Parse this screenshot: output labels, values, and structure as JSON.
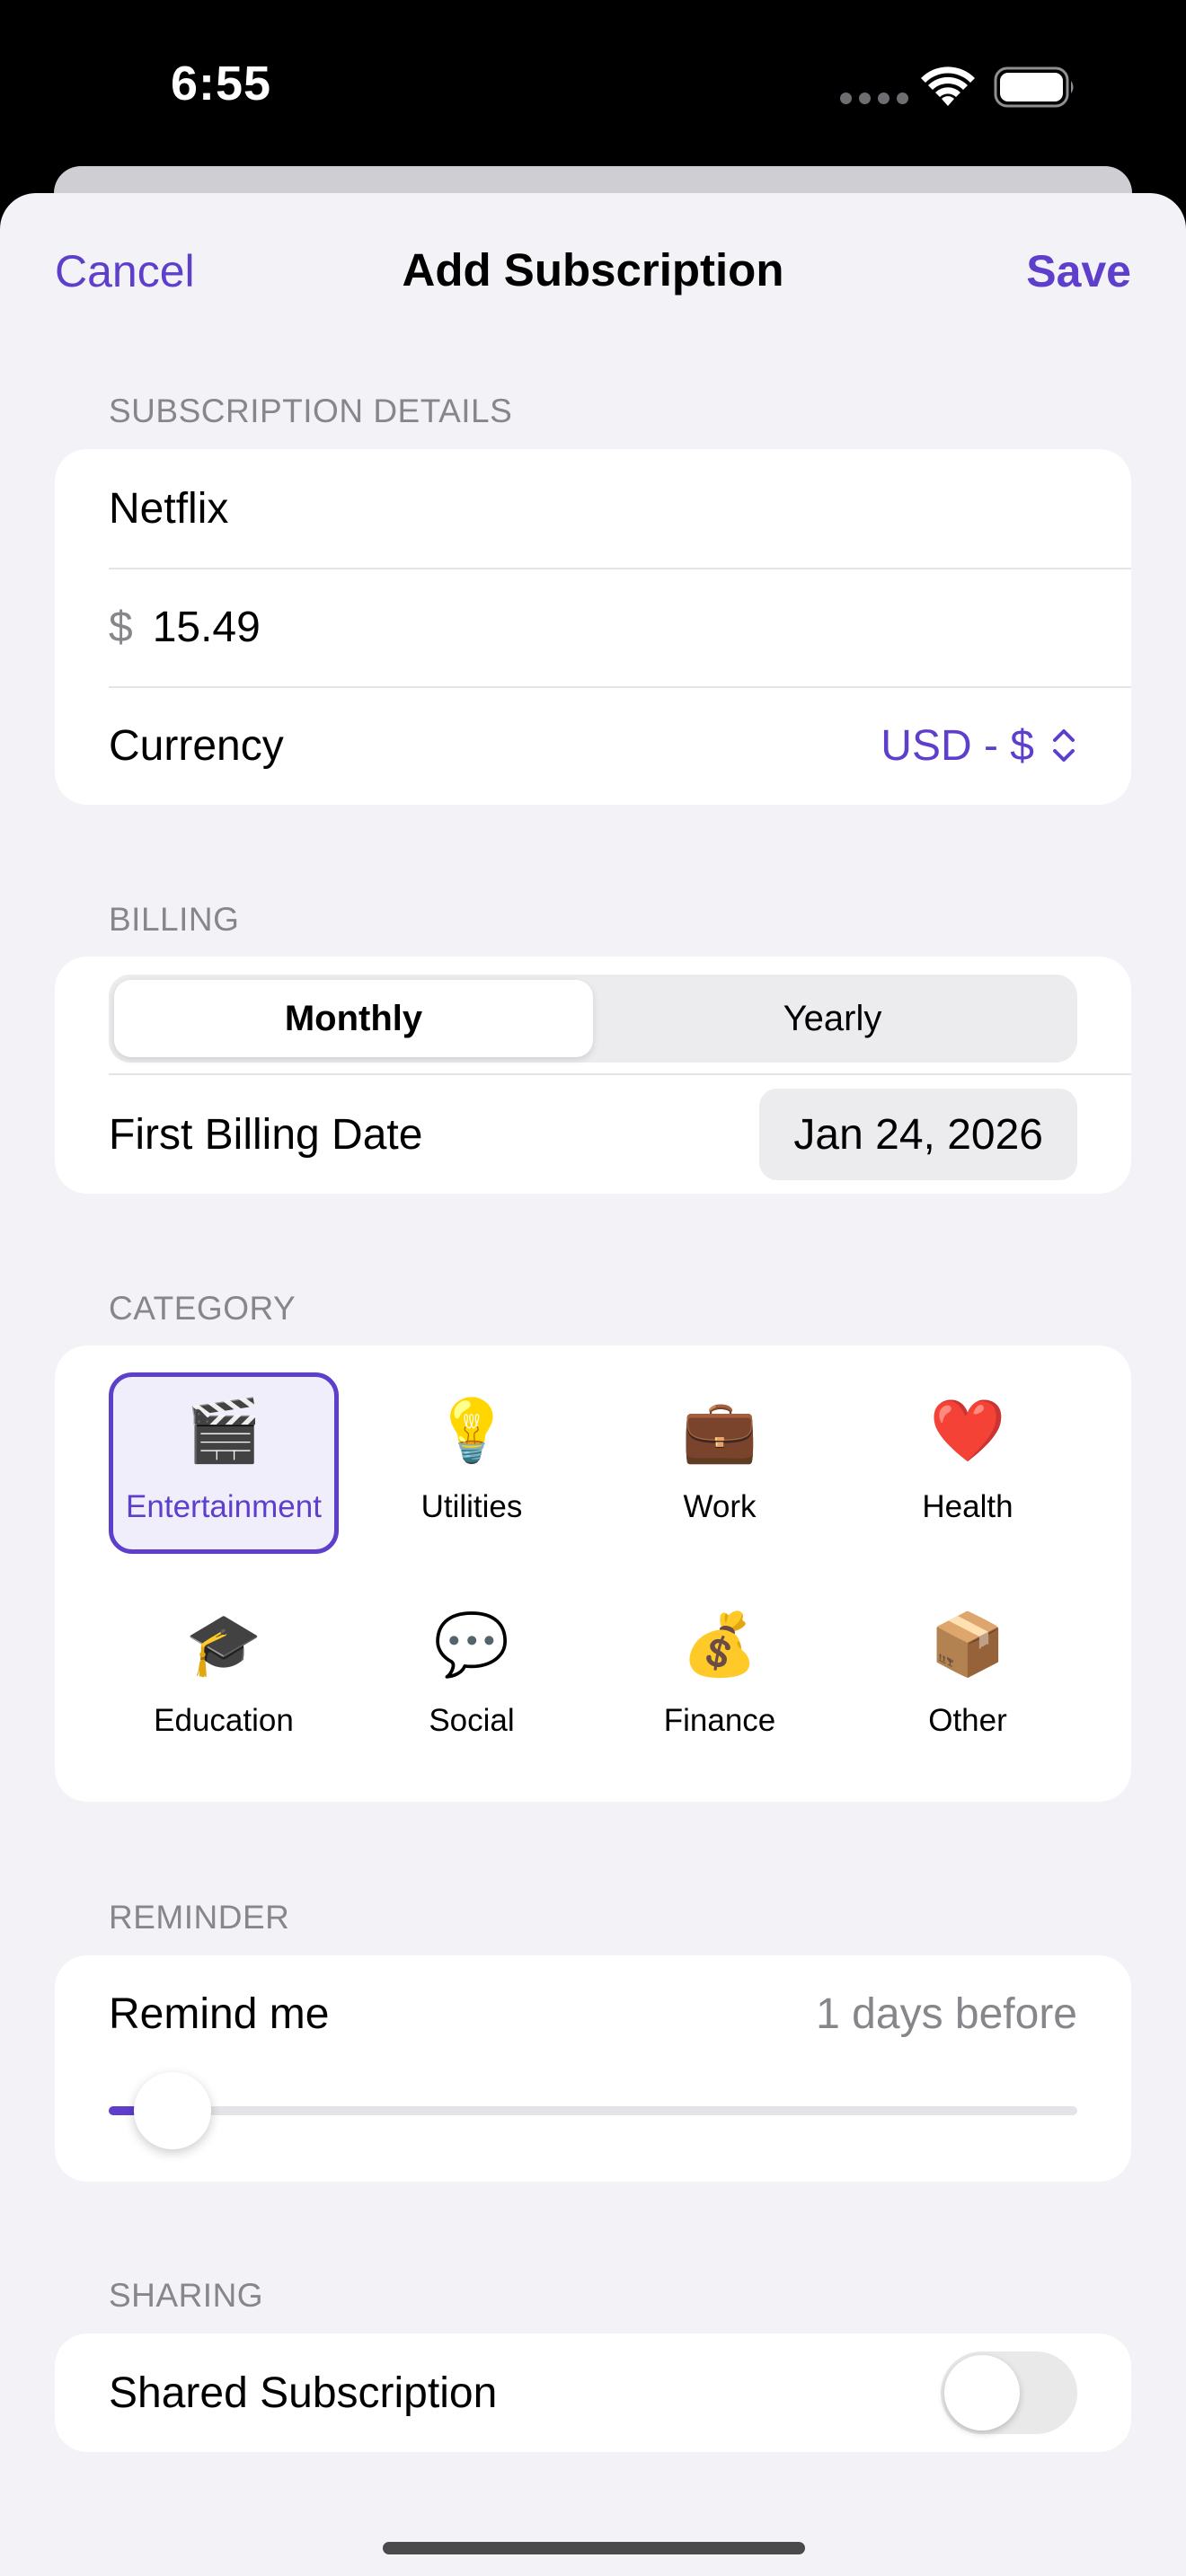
{
  "status_bar": {
    "time": "6:55"
  },
  "nav": {
    "cancel_label": "Cancel",
    "title": "Add Subscription",
    "save_label": "Save"
  },
  "details": {
    "header": "SUBSCRIPTION DETAILS",
    "name_value": "Netflix",
    "price_symbol": "$",
    "price_value": "15.49",
    "currency_label": "Currency",
    "currency_value": "USD - $"
  },
  "billing": {
    "header": "BILLING",
    "segments": [
      "Monthly",
      "Yearly"
    ],
    "selected_segment": "Monthly",
    "first_date_label": "First Billing Date",
    "first_date_value": "Jan 24, 2026"
  },
  "category": {
    "header": "CATEGORY",
    "selected": "Entertainment",
    "items": [
      {
        "label": "Entertainment",
        "icon": "🎬",
        "icon_name": "clapper-board-icon"
      },
      {
        "label": "Utilities",
        "icon": "💡",
        "icon_name": "light-bulb-icon"
      },
      {
        "label": "Work",
        "icon": "💼",
        "icon_name": "briefcase-icon"
      },
      {
        "label": "Health",
        "icon": "❤️",
        "icon_name": "heart-icon"
      },
      {
        "label": "Education",
        "icon": "🎓",
        "icon_name": "graduation-cap-icon"
      },
      {
        "label": "Social",
        "icon": "💬",
        "icon_name": "speech-bubble-icon"
      },
      {
        "label": "Finance",
        "icon": "💰",
        "icon_name": "money-bag-icon"
      },
      {
        "label": "Other",
        "icon": "📦",
        "icon_name": "package-icon"
      }
    ]
  },
  "reminder": {
    "header": "REMINDER",
    "label": "Remind me",
    "value_text": "1 days before",
    "slider_fraction": 0.066
  },
  "sharing": {
    "header": "SHARING",
    "label": "Shared Subscription",
    "enabled": false
  },
  "colors": {
    "accent": "#5e3fcc",
    "background": "#f2f2f7",
    "secondary_text": "#86868b"
  }
}
